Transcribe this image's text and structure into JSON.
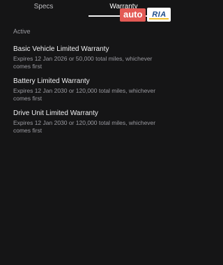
{
  "tabs": [
    {
      "label": "Specs"
    },
    {
      "label": "Warranty"
    }
  ],
  "watermark": {
    "part1": "auto",
    "part2": "RIA"
  },
  "section": {
    "label": "Active"
  },
  "warranties": [
    {
      "title": "Basic Vehicle Limited Warranty",
      "description": "Expires 12 Jan 2026 or 50,000 total miles, whichever comes first"
    },
    {
      "title": "Battery Limited Warranty",
      "description": "Expires 12 Jan 2030 or 120,000 total miles, whichever comes first"
    },
    {
      "title": "Drive Unit Limited Warranty",
      "description": "Expires 12 Jan 2030 or 120,000 total miles, whichever comes first"
    }
  ],
  "colors": {
    "background": "#151516",
    "watermark_red": "#e35a55",
    "watermark_blue": "#1f4e8c",
    "watermark_yellow": "#f2c230"
  }
}
